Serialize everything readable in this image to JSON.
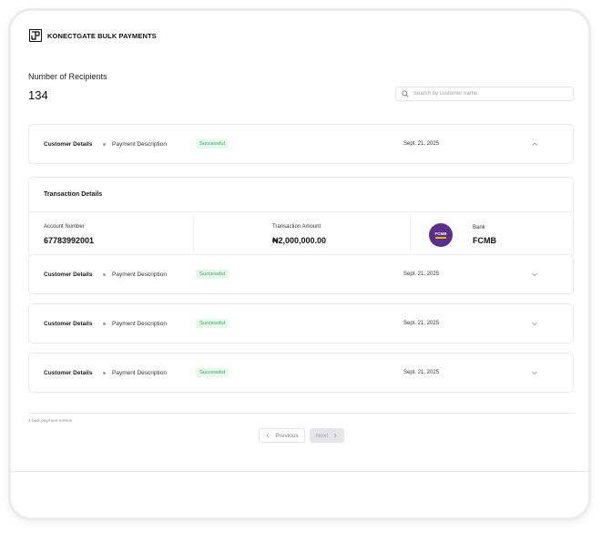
{
  "app": {
    "brand_name": "KONECTGATE BULK PAYMENTS",
    "logo_icon": "swastika-like-square-logo-icon"
  },
  "summary": {
    "label": "Number of Recipients",
    "value": "134"
  },
  "search": {
    "placeholder": "Search by customer name",
    "value": ""
  },
  "rows": [
    {
      "customer": "Customer Details",
      "description": "Payment Description",
      "status": "Successful",
      "date": "Sept. 21, 2025",
      "expanded": true
    },
    {
      "customer": "Customer Details",
      "description": "Payment Description",
      "status": "Successful",
      "date": "Sept. 21, 2025",
      "expanded": false
    },
    {
      "customer": "Customer Details",
      "description": "Payment Description",
      "status": "Successful",
      "date": "Sept. 21, 2025",
      "expanded": false
    },
    {
      "customer": "Customer Details",
      "description": "Payment Description",
      "status": "Successful",
      "date": "Sept. 21, 2025",
      "expanded": false
    }
  ],
  "details": {
    "title": "Transaction Details",
    "account_label": "Account Number",
    "account_value": "67783992001",
    "amount_label": "Transaction Amount",
    "amount_value": "₦2,000,000.00",
    "bank_label": "Bank",
    "bank_value": "FCMB",
    "bank_logo_text": "FCMB"
  },
  "footer": {
    "entries_text": "4 bulk payment entries",
    "prev_label": "Previous",
    "next_label": "Next"
  },
  "colors": {
    "success_bg": "#e7f8ec",
    "success_text": "#2fa75a",
    "bank_purple": "#5b2d8c",
    "bank_yellow": "#f2b705"
  }
}
